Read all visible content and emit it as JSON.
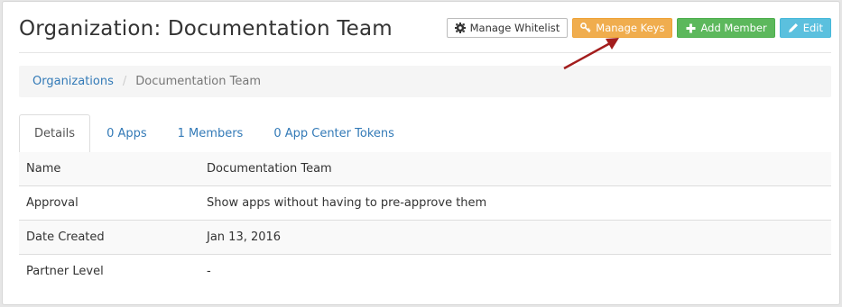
{
  "header": {
    "title": "Organization: Documentation Team",
    "buttons": [
      {
        "label": "Manage Whitelist",
        "icon": "cog-icon",
        "style": "default"
      },
      {
        "label": "Manage Keys",
        "icon": "key-icon",
        "style": "warning"
      },
      {
        "label": "Add Member",
        "icon": "plus-icon",
        "style": "success"
      },
      {
        "label": "Edit",
        "icon": "pencil-icon",
        "style": "info"
      }
    ]
  },
  "breadcrumb": {
    "link": "Organizations",
    "separator": "/",
    "current": "Documentation Team"
  },
  "tabs": [
    {
      "label": "Details",
      "active": true
    },
    {
      "label": "0 Apps",
      "active": false
    },
    {
      "label": "1 Members",
      "active": false
    },
    {
      "label": "0 App Center Tokens",
      "active": false
    }
  ],
  "details": [
    {
      "key": "Name",
      "value": "Documentation Team"
    },
    {
      "key": "Approval",
      "value": "Show apps without having to pre-approve them"
    },
    {
      "key": "Date Created",
      "value": "Jan 13, 2016"
    },
    {
      "key": "Partner Level",
      "value": "-"
    }
  ],
  "colors": {
    "link": "#337ab7",
    "warning": "#f0ad4e",
    "success": "#5cb85c",
    "info": "#5bc0de",
    "annotation_arrow": "#a31d1d"
  }
}
